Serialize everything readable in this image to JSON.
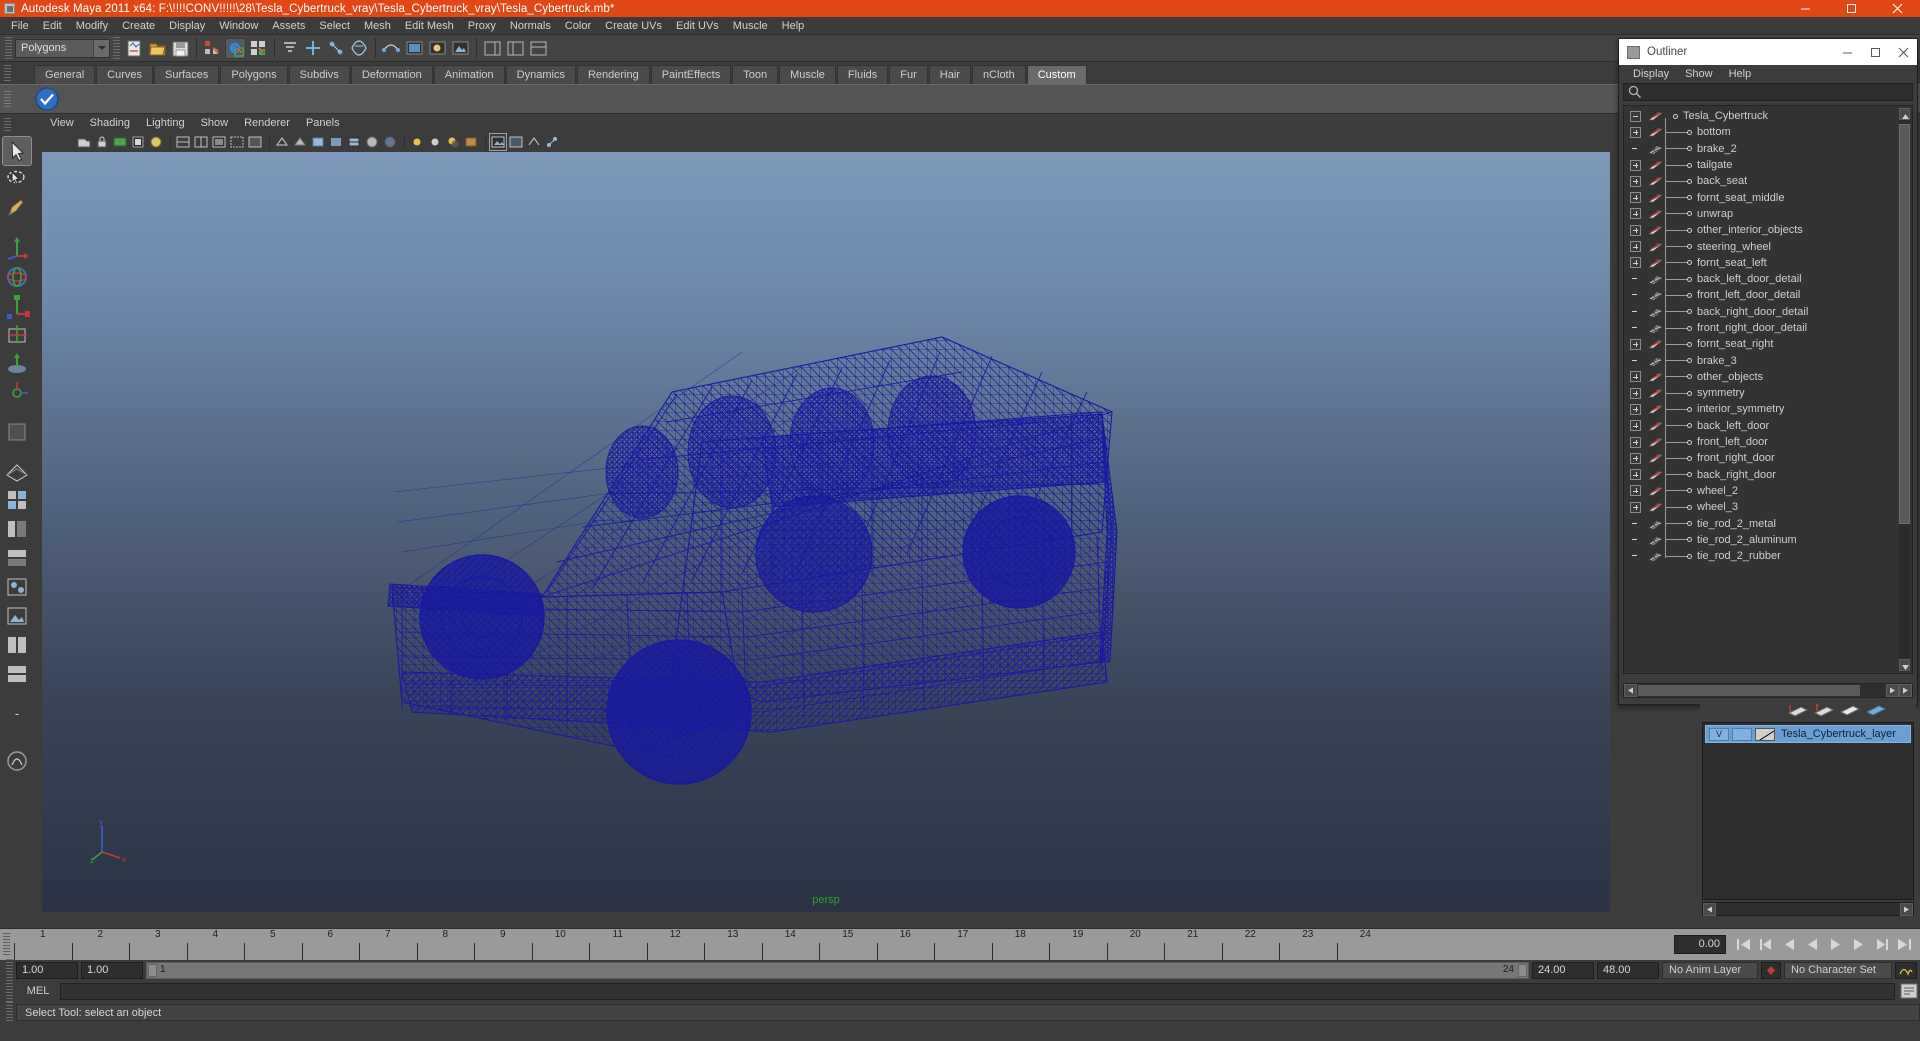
{
  "window": {
    "title": "Autodesk Maya 2011 x64: F:\\!!!!CONV!!!!!\\28\\Tesla_Cybertruck_vray\\Tesla_Cybertruck_vray\\Tesla_Cybertruck.mb*",
    "app_icon": "maya-icon",
    "minimize_label": "—",
    "maximize_label": "☐",
    "close_label": "✕"
  },
  "menubar": {
    "items": [
      {
        "label": "File"
      },
      {
        "label": "Edit"
      },
      {
        "label": "Modify"
      },
      {
        "label": "Create"
      },
      {
        "label": "Display"
      },
      {
        "label": "Window"
      },
      {
        "label": "Assets"
      },
      {
        "label": "Select"
      },
      {
        "label": "Mesh"
      },
      {
        "label": "Edit Mesh"
      },
      {
        "label": "Proxy"
      },
      {
        "label": "Normals"
      },
      {
        "label": "Color"
      },
      {
        "label": "Create UVs"
      },
      {
        "label": "Edit UVs"
      },
      {
        "label": "Muscle"
      },
      {
        "label": "Help"
      }
    ]
  },
  "statusline": {
    "mode_selector": {
      "value": "Polygons",
      "icon": "chevron-down-icon"
    },
    "buttons": [
      {
        "name": "new-scene-icon"
      },
      {
        "name": "open-scene-icon"
      },
      {
        "name": "save-scene-icon"
      },
      {
        "name": "select-by-hierarchy-icon"
      },
      {
        "name": "select-by-object-icon"
      },
      {
        "name": "select-by-component-icon"
      },
      {
        "name": "snap-to-grid-icon"
      },
      {
        "name": "snap-to-curve-icon"
      },
      {
        "name": "snap-to-point-icon"
      },
      {
        "name": "snap-to-view-plane-icon"
      },
      {
        "name": "construction-history-icon"
      },
      {
        "name": "render-current-frame-icon"
      },
      {
        "name": "ipr-render-icon"
      },
      {
        "name": "render-settings-icon"
      },
      {
        "name": "toggle-attribute-editor-icon"
      },
      {
        "name": "toggle-tool-settings-icon"
      },
      {
        "name": "toggle-channel-box-icon"
      }
    ]
  },
  "shelf": {
    "tabs": [
      {
        "label": "General",
        "active": false
      },
      {
        "label": "Curves",
        "active": false
      },
      {
        "label": "Surfaces",
        "active": false
      },
      {
        "label": "Polygons",
        "active": false
      },
      {
        "label": "Subdivs",
        "active": false
      },
      {
        "label": "Deformation",
        "active": false
      },
      {
        "label": "Animation",
        "active": false
      },
      {
        "label": "Dynamics",
        "active": false
      },
      {
        "label": "Rendering",
        "active": false
      },
      {
        "label": "PaintEffects",
        "active": false
      },
      {
        "label": "Toon",
        "active": false
      },
      {
        "label": "Muscle",
        "active": false
      },
      {
        "label": "Fluids",
        "active": false
      },
      {
        "label": "Fur",
        "active": false
      },
      {
        "label": "Hair",
        "active": false
      },
      {
        "label": "nCloth",
        "active": false
      },
      {
        "label": "Custom",
        "active": true
      }
    ],
    "items": [
      {
        "name": "vray-checkmark-icon"
      }
    ]
  },
  "toolbox": {
    "tools": [
      {
        "name": "select-tool",
        "selected": true
      },
      {
        "name": "lasso-select-tool",
        "selected": false
      },
      {
        "name": "paint-select-tool",
        "selected": false
      },
      {
        "name": "move-tool",
        "selected": false
      },
      {
        "name": "rotate-tool",
        "selected": false
      },
      {
        "name": "scale-tool",
        "selected": false
      },
      {
        "name": "universal-manipulator-tool",
        "selected": false
      },
      {
        "name": "soft-modification-tool",
        "selected": false
      },
      {
        "name": "show-manipulator-tool",
        "selected": false
      },
      {
        "name": "last-tool-used",
        "selected": false
      },
      {
        "name": "single-perspective-layout",
        "selected": false
      },
      {
        "name": "four-view-layout",
        "selected": false
      },
      {
        "name": "persp-outliner-layout",
        "selected": false
      },
      {
        "name": "persp-graph-layout",
        "selected": false
      },
      {
        "name": "hypershade-persp-layout",
        "selected": false
      },
      {
        "name": "persp-render-layout",
        "selected": false
      },
      {
        "name": "two-pane-side-layout",
        "selected": false
      },
      {
        "name": "two-pane-stacked-layout",
        "selected": false
      },
      {
        "name": "more-layouts",
        "selected": false
      },
      {
        "name": "paint-effects-canvas",
        "selected": false
      }
    ]
  },
  "viewport": {
    "menu": [
      {
        "label": "View"
      },
      {
        "label": "Shading"
      },
      {
        "label": "Lighting"
      },
      {
        "label": "Show"
      },
      {
        "label": "Renderer"
      },
      {
        "label": "Panels"
      }
    ],
    "camera_label": "persp",
    "axis_labels": {
      "y": "y",
      "x": "x",
      "z": "z"
    },
    "model": {
      "name": "Tesla_Cybertruck",
      "display_mode": "wireframe",
      "wire_color": "#1a1a9e"
    },
    "icons": [
      {
        "name": "select-camera-icon"
      },
      {
        "name": "lock-camera-icon"
      },
      {
        "name": "camera-attributes-icon"
      },
      {
        "name": "bookmark-icon"
      },
      {
        "name": "image-plane-icon"
      },
      {
        "name": "two-d-pan-zoom-icon"
      },
      {
        "name": "grid-toggle-icon"
      },
      {
        "name": "film-gate-icon"
      },
      {
        "name": "resolution-gate-icon"
      },
      {
        "name": "gate-mask-icon"
      },
      {
        "name": "field-chart-icon"
      },
      {
        "name": "safe-action-icon"
      },
      {
        "name": "safe-title-icon"
      },
      {
        "name": "wireframe-shading-icon"
      },
      {
        "name": "smooth-shade-all-icon"
      },
      {
        "name": "smooth-shade-selected-icon"
      },
      {
        "name": "flat-shade-icon"
      },
      {
        "name": "shaded-wireframe-icon"
      },
      {
        "name": "use-default-material-icon"
      },
      {
        "name": "xray-icon"
      },
      {
        "name": "xray-joints-icon"
      },
      {
        "name": "use-all-lights-icon"
      },
      {
        "name": "use-selected-lights-icon"
      },
      {
        "name": "shadows-icon"
      },
      {
        "name": "hardware-texturing-icon"
      },
      {
        "name": "high-quality-render-icon"
      },
      {
        "name": "viewport2-icon"
      },
      {
        "name": "isolate-select-icon"
      }
    ]
  },
  "outliner": {
    "title": "Outliner",
    "menu": [
      {
        "label": "Display"
      },
      {
        "label": "Show"
      },
      {
        "label": "Help"
      }
    ],
    "search_placeholder": "",
    "minimize_label": "—",
    "maximize_label": "☐",
    "close_label": "✕",
    "nodes": [
      {
        "label": "Tesla_Cybertruck",
        "expander": "minus",
        "icon": "transform-icon",
        "root": true
      },
      {
        "label": "bottom",
        "expander": "plus",
        "icon": "transform-icon"
      },
      {
        "label": "brake_2",
        "expander": "none",
        "icon": "mesh-icon"
      },
      {
        "label": "tailgate",
        "expander": "plus",
        "icon": "transform-icon"
      },
      {
        "label": "back_seat",
        "expander": "plus",
        "icon": "transform-icon"
      },
      {
        "label": "fornt_seat_middle",
        "expander": "plus",
        "icon": "transform-icon"
      },
      {
        "label": "unwrap",
        "expander": "plus",
        "icon": "transform-icon"
      },
      {
        "label": "other_interior_objects",
        "expander": "plus",
        "icon": "transform-icon"
      },
      {
        "label": "steering_wheel",
        "expander": "plus",
        "icon": "transform-icon"
      },
      {
        "label": "fornt_seat_left",
        "expander": "plus",
        "icon": "transform-icon"
      },
      {
        "label": "back_left_door_detail",
        "expander": "none",
        "icon": "mesh-icon"
      },
      {
        "label": "front_left_door_detail",
        "expander": "none",
        "icon": "mesh-icon"
      },
      {
        "label": "back_right_door_detail",
        "expander": "none",
        "icon": "mesh-icon"
      },
      {
        "label": "front_right_door_detail",
        "expander": "none",
        "icon": "mesh-icon"
      },
      {
        "label": "fornt_seat_right",
        "expander": "plus",
        "icon": "transform-icon"
      },
      {
        "label": "brake_3",
        "expander": "none",
        "icon": "mesh-icon"
      },
      {
        "label": "other_objects",
        "expander": "plus",
        "icon": "transform-icon"
      },
      {
        "label": "symmetry",
        "expander": "plus",
        "icon": "transform-icon"
      },
      {
        "label": "interior_symmetry",
        "expander": "plus",
        "icon": "transform-icon"
      },
      {
        "label": "back_left_door",
        "expander": "plus",
        "icon": "transform-icon"
      },
      {
        "label": "front_left_door",
        "expander": "plus",
        "icon": "transform-icon"
      },
      {
        "label": "front_right_door",
        "expander": "plus",
        "icon": "transform-icon"
      },
      {
        "label": "back_right_door",
        "expander": "plus",
        "icon": "transform-icon"
      },
      {
        "label": "wheel_2",
        "expander": "plus",
        "icon": "transform-icon"
      },
      {
        "label": "wheel_3",
        "expander": "plus",
        "icon": "transform-icon"
      },
      {
        "label": "tie_rod_2_metal",
        "expander": "none",
        "icon": "mesh-icon"
      },
      {
        "label": "tie_rod_2_aluminum",
        "expander": "none",
        "icon": "mesh-icon"
      },
      {
        "label": "tie_rod_2_rubber",
        "expander": "none",
        "icon": "mesh-icon"
      }
    ]
  },
  "layers": {
    "tab_icons": [
      {
        "name": "layer-new-icon"
      },
      {
        "name": "layer-new-selected-icon"
      },
      {
        "name": "layer-sort-icon"
      },
      {
        "name": "layer-options-icon"
      }
    ],
    "items": [
      {
        "visibility": "V",
        "playback": "",
        "color_swatch": "#cfcfcf",
        "name": "Tesla_Cybertruck_layer",
        "selected": true
      }
    ]
  },
  "timeline": {
    "ticks": [
      1,
      2,
      3,
      4,
      5,
      6,
      7,
      8,
      9,
      10,
      11,
      12,
      13,
      14,
      15,
      16,
      17,
      18,
      19,
      20,
      21,
      22,
      23,
      24
    ],
    "current_frame": "0.00",
    "playback_buttons": [
      {
        "name": "go-to-start-button",
        "glyph": "⏮"
      },
      {
        "name": "step-back-keyframe-button",
        "glyph": "⏴"
      },
      {
        "name": "step-back-frame-button",
        "glyph": "◀"
      },
      {
        "name": "play-backwards-button",
        "glyph": "◀"
      },
      {
        "name": "play-forwards-button",
        "glyph": "▶"
      },
      {
        "name": "step-forward-frame-button",
        "glyph": "▶"
      },
      {
        "name": "step-forward-keyframe-button",
        "glyph": "⏵"
      },
      {
        "name": "go-to-end-button",
        "glyph": "⏭"
      }
    ]
  },
  "rangebar": {
    "start_field": "1.00",
    "playback_start_field": "1.00",
    "range_start_label": "1",
    "range_end_label": "24",
    "playback_end_field": "24.00",
    "end_field": "48.00",
    "anim_layer": "No Anim Layer",
    "character_set": "No Character Set",
    "auto_key_icon": "auto-keyframe-icon",
    "anim_prefs_icon": "animation-preferences-icon"
  },
  "commandline": {
    "language_label": "MEL",
    "input_value": "",
    "script_editor_icon": "script-editor-icon"
  },
  "helpline": {
    "message": "Select Tool: select an object"
  }
}
